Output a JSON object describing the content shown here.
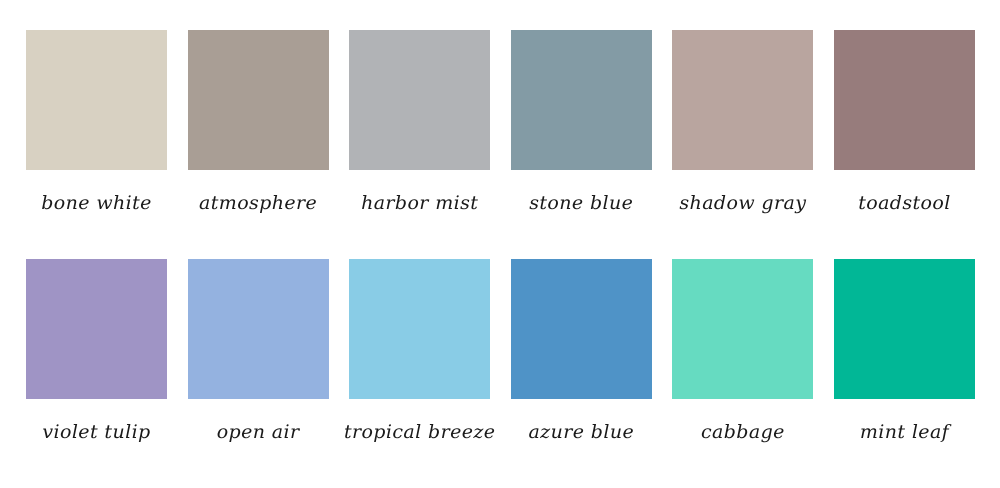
{
  "swatches": [
    {
      "name": "bone white",
      "color": "#d8d1c2"
    },
    {
      "name": "atmosphere",
      "color": "#a99e95"
    },
    {
      "name": "harbor mist",
      "color": "#b1b3b6"
    },
    {
      "name": "stone blue",
      "color": "#839ba5"
    },
    {
      "name": "shadow gray",
      "color": "#b9a59f"
    },
    {
      "name": "toadstool",
      "color": "#977c7c"
    },
    {
      "name": "violet tulip",
      "color": "#9f94c5"
    },
    {
      "name": "open air",
      "color": "#94b2e0"
    },
    {
      "name": "tropical breeze",
      "color": "#89cce6"
    },
    {
      "name": "azure blue",
      "color": "#4f93c7"
    },
    {
      "name": "cabbage",
      "color": "#66dbc1"
    },
    {
      "name": "mint leaf",
      "color": "#01b796"
    }
  ]
}
